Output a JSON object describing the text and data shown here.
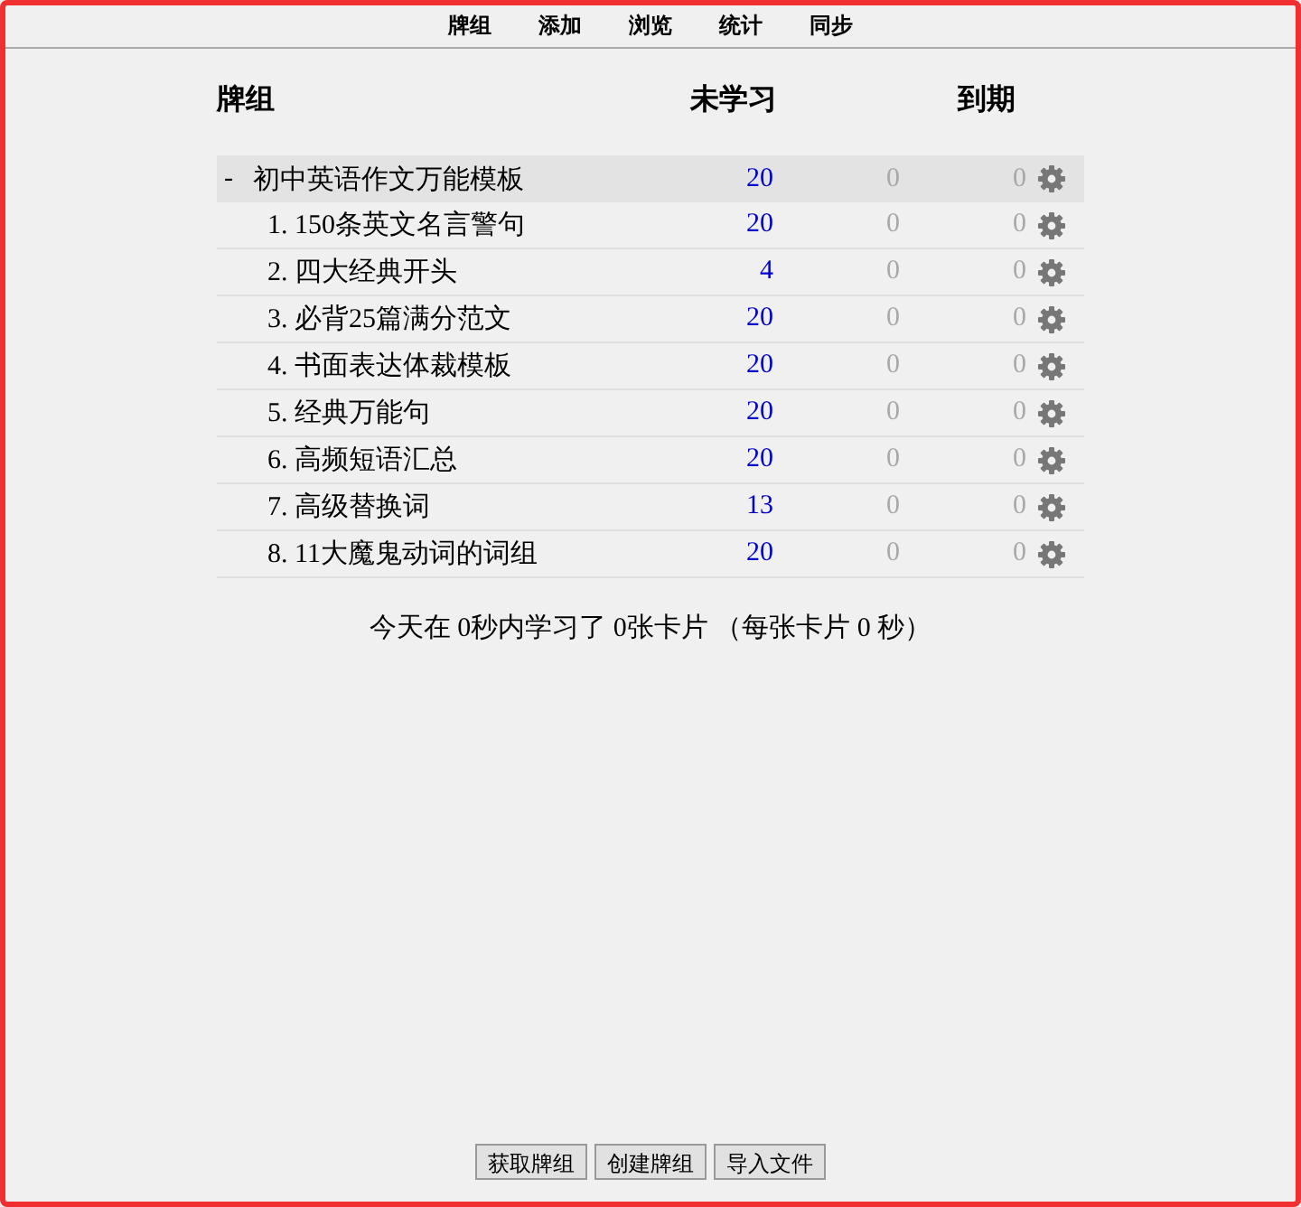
{
  "toolbar": [
    "牌组",
    "添加",
    "浏览",
    "统计",
    "同步"
  ],
  "table": {
    "columns": [
      "牌组",
      "未学习",
      "到期"
    ],
    "decks": [
      {
        "name": "初中英语作文万能模板",
        "toggle": "-",
        "expanded": true,
        "selected": true,
        "new": "20",
        "learn": "0",
        "due": "0",
        "children": [
          {
            "name": "1. 150条英文名言警句",
            "selected": false,
            "new": "20",
            "learn": "0",
            "due": "0"
          },
          {
            "name": "2. 四大经典开头",
            "selected": false,
            "new": "4",
            "learn": "0",
            "due": "0"
          },
          {
            "name": "3. 必背25篇满分范文",
            "selected": false,
            "new": "20",
            "learn": "0",
            "due": "0"
          },
          {
            "name": "4. 书面表达体裁模板",
            "selected": false,
            "new": "20",
            "learn": "0",
            "due": "0"
          },
          {
            "name": "5. 经典万能句",
            "selected": false,
            "new": "20",
            "learn": "0",
            "due": "0"
          },
          {
            "name": "6. 高频短语汇总",
            "selected": false,
            "new": "20",
            "learn": "0",
            "due": "0"
          },
          {
            "name": "7. 高级替换词",
            "selected": false,
            "new": "13",
            "learn": "0",
            "due": "0"
          },
          {
            "name": "8. 11大魔鬼动词的词组",
            "selected": false,
            "new": "20",
            "learn": "0",
            "due": "0"
          }
        ]
      }
    ]
  },
  "summary": "今天在 0秒内学习了 0张卡片 （每张卡片 0 秒）",
  "buttons": [
    "获取牌组",
    "创建牌组",
    "导入文件"
  ]
}
